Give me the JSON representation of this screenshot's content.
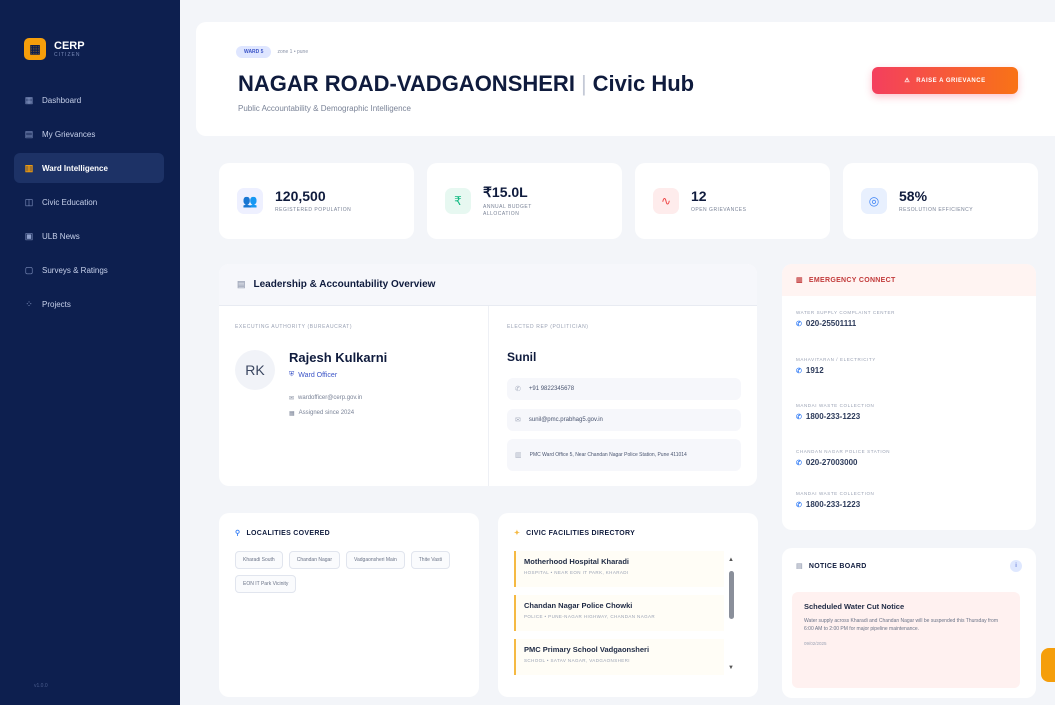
{
  "brand": {
    "name": "CERP",
    "sub": "CITIZEN"
  },
  "nav": [
    {
      "label": "Dashboard",
      "icon": "grid-icon"
    },
    {
      "label": "My Grievances",
      "icon": "file-icon"
    },
    {
      "label": "Ward Intelligence",
      "icon": "building-icon"
    },
    {
      "label": "Civic Education",
      "icon": "book-icon"
    },
    {
      "label": "ULB News",
      "icon": "news-icon"
    },
    {
      "label": "Surveys & Ratings",
      "icon": "clipboard-icon"
    },
    {
      "label": "Projects",
      "icon": "apps-icon"
    }
  ],
  "sidebar_footer": "v1.0.0",
  "header": {
    "ward_pill": "WARD 5",
    "zone": "zone 1 • pune",
    "title_main": "NAGAR ROAD-VADGAONSHERI",
    "title_sep": "|",
    "title_suffix": "Civic Hub",
    "subtitle": "Public Accountability & Demographic Intelligence",
    "raise_button": "RAISE A GRIEVANCE"
  },
  "stats": [
    {
      "value": "120,500",
      "label": "REGISTERED POPULATION",
      "icon": "users-icon",
      "color": "#6366f1",
      "bg": "#eef0ff"
    },
    {
      "value": "₹15.0L",
      "label": "ANNUAL BUDGET ALLOCATION",
      "icon": "rupee-icon",
      "color": "#10b981",
      "bg": "#e7f8f1"
    },
    {
      "value": "12",
      "label": "OPEN GRIEVANCES",
      "icon": "pulse-icon",
      "color": "#ef4444",
      "bg": "#feecec"
    },
    {
      "value": "58%",
      "label": "RESOLUTION EFFICIENCY",
      "icon": "check-circle-icon",
      "color": "#3b82f6",
      "bg": "#e8f0fe"
    }
  ],
  "leadership": {
    "title": "Leadership & Accountability Overview",
    "left_label": "EXECUTING AUTHORITY (BUREAUCRAT)",
    "right_label": "ELECTED REP (POLITICIAN)",
    "officer": {
      "initials": "RK",
      "name": "Rajesh Kulkarni",
      "role": "Ward Officer",
      "email": "wardofficer@cerp.gov.in",
      "assigned": "Assigned since 2024"
    },
    "elected": {
      "name": "Sunil",
      "phone": "+91 9822345678",
      "email": "sunil@pmc.prabhag5.gov.in",
      "address": "PMC Ward Office 5, Near Chandan Nagar Police Station, Pune 411014"
    }
  },
  "emergency": {
    "title": "EMERGENCY CONNECT",
    "items": [
      {
        "label": "WATER SUPPLY COMPLAINT CENTER",
        "number": "020-25501111"
      },
      {
        "label": "MAHAVITARAN / ELECTRICITY",
        "number": "1912"
      },
      {
        "label": "MANDAI WASTE COLLECTION",
        "number": "1800-233-1223"
      },
      {
        "label": "CHANDAN NAGAR POLICE STATION",
        "number": "020-27003000"
      },
      {
        "label": "MANDAI WASTE COLLECTION",
        "number": "1800-233-1223"
      }
    ]
  },
  "localities": {
    "title": "LOCALITIES COVERED",
    "chips": [
      "Kharadi South",
      "Chandan Nagar",
      "Vadgaonsheri Main",
      "Thite Vasti",
      "EON IT Park Vicinity"
    ]
  },
  "facilities": {
    "title": "CIVIC FACILITIES DIRECTORY",
    "items": [
      {
        "name": "Motherhood Hospital Kharadi",
        "sub": "HOSPITAL • NEAR EON IT PARK, KHARADI"
      },
      {
        "name": "Chandan Nagar Police Chowki",
        "sub": "POLICE • PUNE-NAGAR HIGHWAY, CHANDAN NAGAR"
      },
      {
        "name": "PMC Primary School Vadgaonsheri",
        "sub": "SCHOOL • SATAV NAGAR, VADGAONSHERI"
      }
    ]
  },
  "notice": {
    "title": "NOTICE BOARD",
    "item_title": "Scheduled Water Cut Notice",
    "item_body": "Water supply across Kharadi and Chandan Nagar will be suspended this Thursday from 6:00 AM to 2:00 PM for major pipeline maintenance.",
    "item_date": "09/02/2025"
  }
}
